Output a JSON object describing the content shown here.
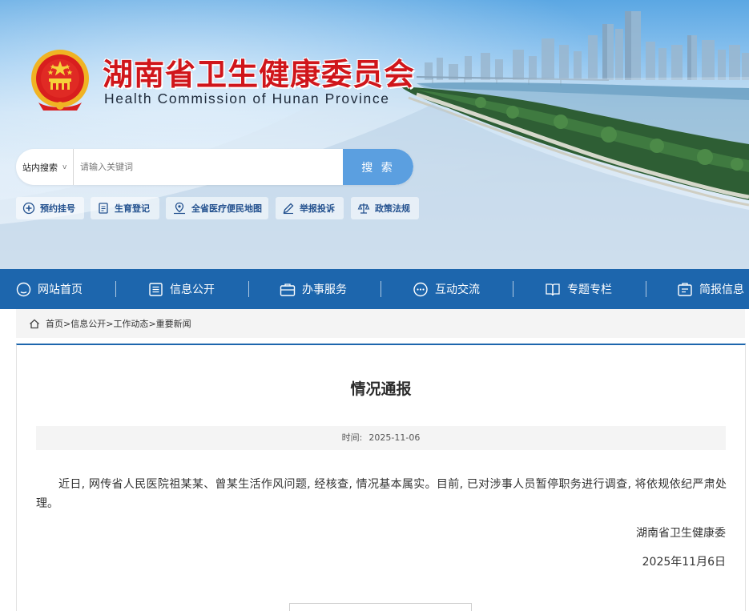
{
  "header": {
    "title": "湖南省卫生健康委员会",
    "subtitle": "Health Commission of Hunan Province",
    "emblem_icon": "national-emblem-icon"
  },
  "search": {
    "scope_label": "站内搜索",
    "scope_chevron": "v",
    "placeholder": "请输入关键词",
    "button_label": "搜 索"
  },
  "quick_links": [
    {
      "label": "预约挂号",
      "icon": "hospital-cross-icon"
    },
    {
      "label": "生育登记",
      "icon": "document-icon"
    },
    {
      "label": "全省医疗便民地图",
      "icon": "map-pin-icon"
    },
    {
      "label": "举报投诉",
      "icon": "pencil-icon"
    },
    {
      "label": "政策法规",
      "icon": "scales-icon"
    }
  ],
  "nav": {
    "items": [
      {
        "label": "网站首页",
        "icon": "home-icon"
      },
      {
        "label": "信息公开",
        "icon": "list-icon"
      },
      {
        "label": "办事服务",
        "icon": "briefcase-icon"
      },
      {
        "label": "互动交流",
        "icon": "chat-icon"
      },
      {
        "label": "专题专栏",
        "icon": "book-icon"
      },
      {
        "label": "简报信息",
        "icon": "report-icon"
      }
    ]
  },
  "breadcrumb": {
    "icon": "home-icon",
    "items": [
      "首页",
      "信息公开",
      "工作动态",
      "重要新闻"
    ],
    "separator": ">"
  },
  "article": {
    "title": "情况通报",
    "time_label": "时间:",
    "time_value": "2025-11-06",
    "body": "近日, 网传省人民医院祖某某、曾某生活作风问题, 经核查, 情况基本属实。目前, 已对涉事人员暂停职务进行调查, 将依规依纪严肃处理。",
    "signature": "湖南省卫生健康委",
    "sign_date": "2025年11月6日"
  },
  "colors": {
    "nav_bg": "#1d66ad",
    "title_red": "#d0161b",
    "search_button": "#5b9fe0",
    "quick_link_text": "#22508e"
  }
}
